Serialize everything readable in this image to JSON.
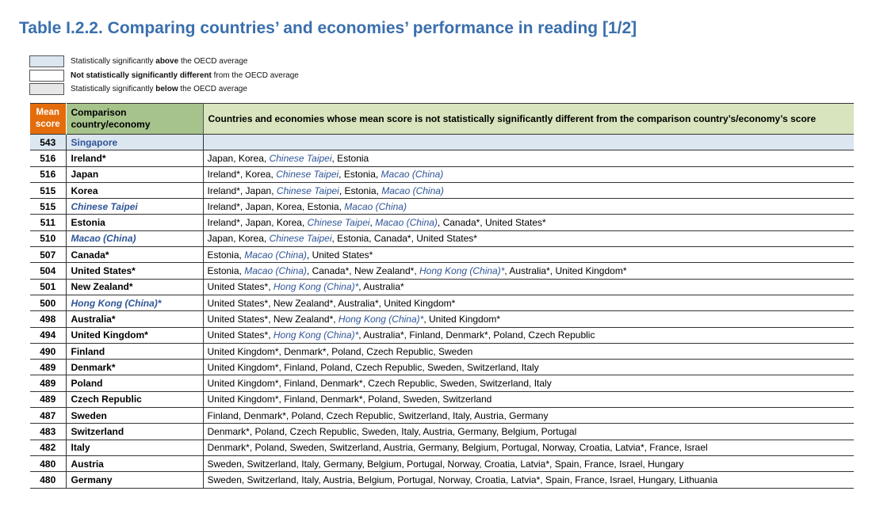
{
  "title": "Table I.2.2. Comparing countries’ and economies’ performance in reading [1/2]",
  "legend": {
    "above": {
      "pre": "Statistically significantly ",
      "bold": "above",
      "post": " the OECD average",
      "color": "#dce6f0"
    },
    "notsig": {
      "pre": "",
      "bold": "Not statistically significantly different",
      "post": " from the OECD average",
      "color": "#ffffff"
    },
    "below": {
      "pre": "Statistically significantly ",
      "bold": "below",
      "post": " the OECD average",
      "color": "#e7e7e7"
    }
  },
  "headers": {
    "mean": "Mean score",
    "comparison": "Comparison country/economy",
    "countries": "Countries and economies whose mean score is not statistically significantly different from the comparison country’s/economy’s score"
  },
  "rows": [
    {
      "score": "543",
      "country": "Singapore",
      "country_style": "blue",
      "row_style": "above",
      "list": []
    },
    {
      "score": "516",
      "country": "Ireland*",
      "list": [
        [
          "Japan, Korea, ",
          ""
        ],
        [
          "Chinese Taipei",
          "i"
        ],
        [
          ", Estonia",
          ""
        ]
      ]
    },
    {
      "score": "516",
      "country": "Japan",
      "list": [
        [
          "Ireland*, Korea, ",
          ""
        ],
        [
          "Chinese Taipei",
          "i"
        ],
        [
          ", Estonia, ",
          ""
        ],
        [
          "Macao (China)",
          "i"
        ]
      ]
    },
    {
      "score": "515",
      "country": "Korea",
      "list": [
        [
          "Ireland*, Japan, ",
          ""
        ],
        [
          "Chinese Taipei",
          "i"
        ],
        [
          ", Estonia, ",
          ""
        ],
        [
          "Macao (China)",
          "i"
        ]
      ]
    },
    {
      "score": "515",
      "country": "Chinese Taipei",
      "country_style": "ital",
      "list": [
        [
          "Ireland*, Japan, Korea, Estonia, ",
          ""
        ],
        [
          "Macao (China)",
          "i"
        ]
      ]
    },
    {
      "score": "511",
      "country": "Estonia",
      "list": [
        [
          "Ireland*, Japan, Korea, ",
          ""
        ],
        [
          "Chinese Taipei",
          "i"
        ],
        [
          ", ",
          ""
        ],
        [
          "Macao (China)",
          "i"
        ],
        [
          ", Canada*, United States*",
          ""
        ]
      ]
    },
    {
      "score": "510",
      "country": "Macao (China)",
      "country_style": "ital",
      "list": [
        [
          "Japan, Korea, ",
          ""
        ],
        [
          "Chinese Taipei",
          "i"
        ],
        [
          ", Estonia, Canada*, United States*",
          ""
        ]
      ]
    },
    {
      "score": "507",
      "country": "Canada*",
      "list": [
        [
          "Estonia, ",
          ""
        ],
        [
          "Macao (China)",
          "i"
        ],
        [
          ", United States*",
          ""
        ]
      ]
    },
    {
      "score": "504",
      "country": "United States*",
      "list": [
        [
          "Estonia, ",
          ""
        ],
        [
          "Macao (China)",
          "i"
        ],
        [
          ", Canada*, New Zealand*, ",
          ""
        ],
        [
          "Hong Kong (China)*",
          "i"
        ],
        [
          ", Australia*, United Kingdom*",
          ""
        ]
      ]
    },
    {
      "score": "501",
      "country": "New Zealand*",
      "list": [
        [
          "United States*, ",
          ""
        ],
        [
          "Hong Kong (China)*",
          "i"
        ],
        [
          ", Australia*",
          ""
        ]
      ]
    },
    {
      "score": "500",
      "country": "Hong Kong (China)*",
      "country_style": "ital",
      "list": [
        [
          "United States*, New Zealand*, Australia*, United Kingdom*",
          ""
        ]
      ]
    },
    {
      "score": "498",
      "country": "Australia*",
      "list": [
        [
          "United States*, New Zealand*, ",
          ""
        ],
        [
          "Hong Kong (China)*",
          "i"
        ],
        [
          ", United Kingdom*",
          ""
        ]
      ]
    },
    {
      "score": "494",
      "country": "United Kingdom*",
      "list": [
        [
          "United States*, ",
          ""
        ],
        [
          "Hong Kong (China)*",
          "i"
        ],
        [
          ", Australia*, Finland, Denmark*, Poland, Czech Republic",
          ""
        ]
      ]
    },
    {
      "score": "490",
      "country": "Finland",
      "list": [
        [
          "United Kingdom*, Denmark*, Poland, Czech Republic, Sweden",
          ""
        ]
      ]
    },
    {
      "score": "489",
      "country": "Denmark*",
      "list": [
        [
          "United Kingdom*, Finland, Poland, Czech Republic, Sweden, Switzerland, Italy",
          ""
        ]
      ]
    },
    {
      "score": "489",
      "country": "Poland",
      "list": [
        [
          "United Kingdom*, Finland, Denmark*, Czech Republic, Sweden, Switzerland, Italy",
          ""
        ]
      ]
    },
    {
      "score": "489",
      "country": "Czech Republic",
      "list": [
        [
          "United Kingdom*, Finland, Denmark*, Poland, Sweden, Switzerland",
          ""
        ]
      ]
    },
    {
      "score": "487",
      "country": "Sweden",
      "list": [
        [
          "Finland, Denmark*, Poland, Czech Republic, Switzerland, Italy, Austria, Germany",
          ""
        ]
      ]
    },
    {
      "score": "483",
      "country": "Switzerland",
      "list": [
        [
          "Denmark*, Poland, Czech Republic, Sweden, Italy, Austria, Germany, Belgium, Portugal",
          ""
        ]
      ]
    },
    {
      "score": "482",
      "country": "Italy",
      "list": [
        [
          "Denmark*, Poland, Sweden, Switzerland, Austria, Germany, Belgium, Portugal, Norway, Croatia, Latvia*, France, Israel",
          ""
        ]
      ]
    },
    {
      "score": "480",
      "country": "Austria",
      "list": [
        [
          "Sweden, Switzerland, Italy, Germany, Belgium, Portugal, Norway, Croatia, Latvia*, Spain, France, Israel, Hungary",
          ""
        ]
      ]
    },
    {
      "score": "480",
      "country": "Germany",
      "list": [
        [
          "Sweden, Switzerland, Italy, Austria, Belgium, Portugal, Norway, Croatia, Latvia*, Spain, France, Israel, Hungary, Lithuania",
          ""
        ]
      ]
    }
  ]
}
